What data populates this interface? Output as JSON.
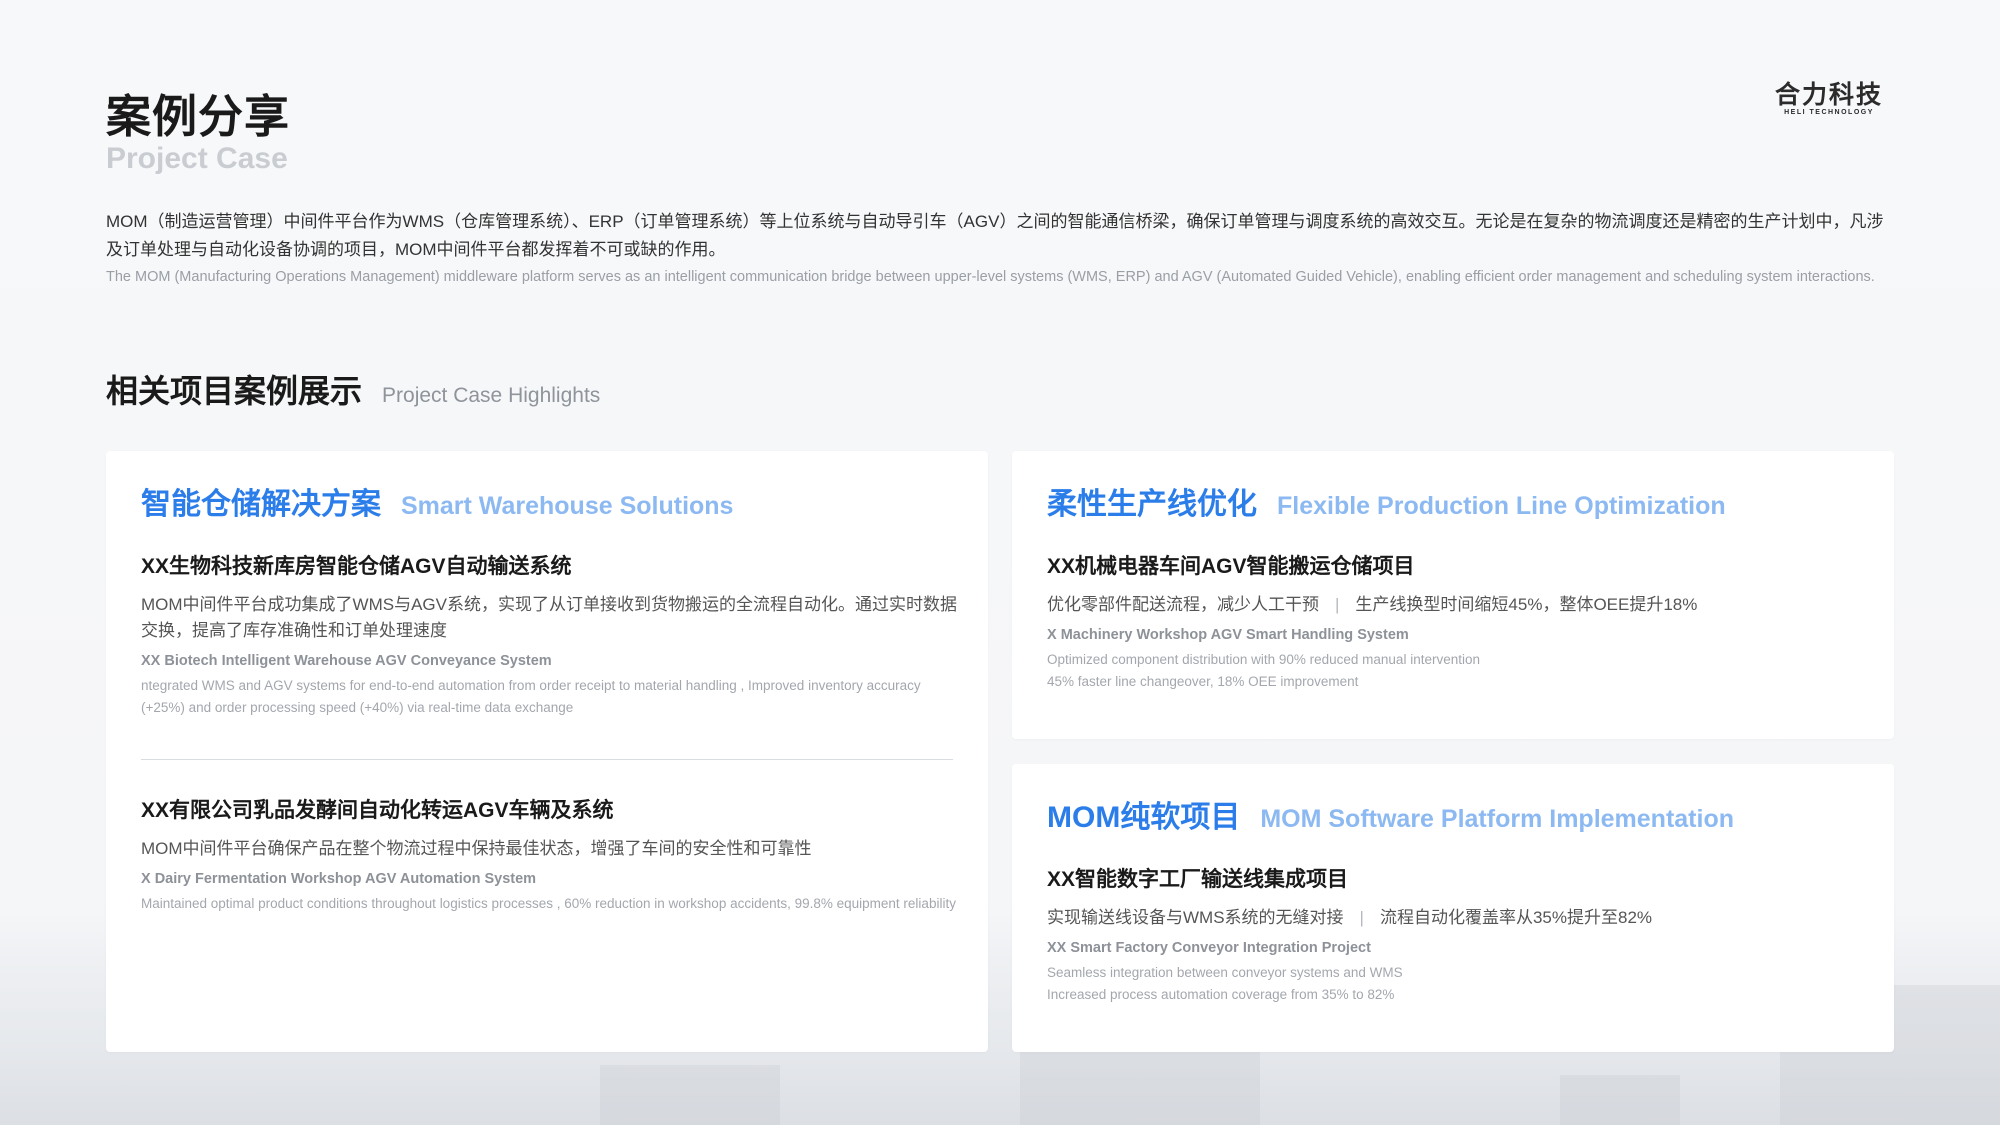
{
  "header": {
    "title": "案例分享",
    "subtitle": "Project Case",
    "logo_cn": "合力科技",
    "logo_en": "HELI TECHNOLOGY"
  },
  "intro": {
    "cn": "MOM（制造运营管理）中间件平台作为WMS（仓库管理系统）、ERP（订单管理系统）等上位系统与自动导引车（AGV）之间的智能通信桥梁，确保订单管理与调度系统的高效交互。无论是在复杂的物流调度还是精密的生产计划中，凡涉及订单处理与自动化设备协调的项目，MOM中间件平台都发挥着不可或缺的作用。",
    "en": "The MOM (Manufacturing Operations Management) middleware platform serves as an intelligent communication bridge between upper-level systems (WMS, ERP) and AGV (Automated Guided Vehicle), enabling efficient order management and scheduling system interactions."
  },
  "section": {
    "title_cn": "相关项目案例展示",
    "title_en": "Project Case Highlights"
  },
  "cards": [
    {
      "title_cn": "智能仓储解决方案",
      "title_en": "Smart Warehouse Solutions",
      "projects": [
        {
          "title": "XX生物科技新库房智能仓储AGV自动输送系统",
          "desc": "MOM中间件平台成功集成了WMS与AGV系统，实现了从订单接收到货物搬运的全流程自动化。通过实时数据交换，提高了库存准确性和订单处理速度",
          "en_title": "XX Biotech Intelligent Warehouse AGV Conveyance System",
          "en_desc": "ntegrated WMS and AGV systems for end-to-end automation from order receipt to material handling , Improved inventory accuracy (+25%) and order processing speed (+40%) via real-time data exchange"
        },
        {
          "title": "XX有限公司乳品发酵间自动化转运AGV车辆及系统",
          "desc": "MOM中间件平台确保产品在整个物流过程中保持最佳状态，增强了车间的安全性和可靠性",
          "en_title": "X Dairy Fermentation Workshop AGV Automation System",
          "en_desc": "Maintained optimal product conditions throughout logistics processes , 60% reduction in workshop accidents, 99.8% equipment reliability"
        }
      ]
    },
    {
      "title_cn": "柔性生产线优化",
      "title_en": "Flexible Production Line Optimization",
      "projects": [
        {
          "title": "XX机械电器车间AGV智能搬运仓储项目",
          "desc_a": "优化零部件配送流程，减少人工干预",
          "desc_sep": "|",
          "desc_b": "生产线换型时间缩短45%，整体OEE提升18%",
          "en_title": "X Machinery Workshop AGV Smart Handling System",
          "en_desc_1": "Optimized component distribution with 90% reduced manual intervention",
          "en_desc_2": "45% faster line changeover, 18% OEE improvement"
        }
      ]
    },
    {
      "title_cn": "MOM纯软项目",
      "title_en": "MOM Software Platform Implementation",
      "projects": [
        {
          "title": "XX智能数字工厂输送线集成项目",
          "desc_a": "实现输送线设备与WMS系统的无缝对接",
          "desc_sep": "|",
          "desc_b": "流程自动化覆盖率从35%提升至82%",
          "en_title": "XX Smart Factory Conveyor Integration Project",
          "en_desc_1": "Seamless integration between conveyor systems and WMS",
          "en_desc_2": "Increased process automation coverage from 35% to 82%"
        }
      ]
    }
  ]
}
